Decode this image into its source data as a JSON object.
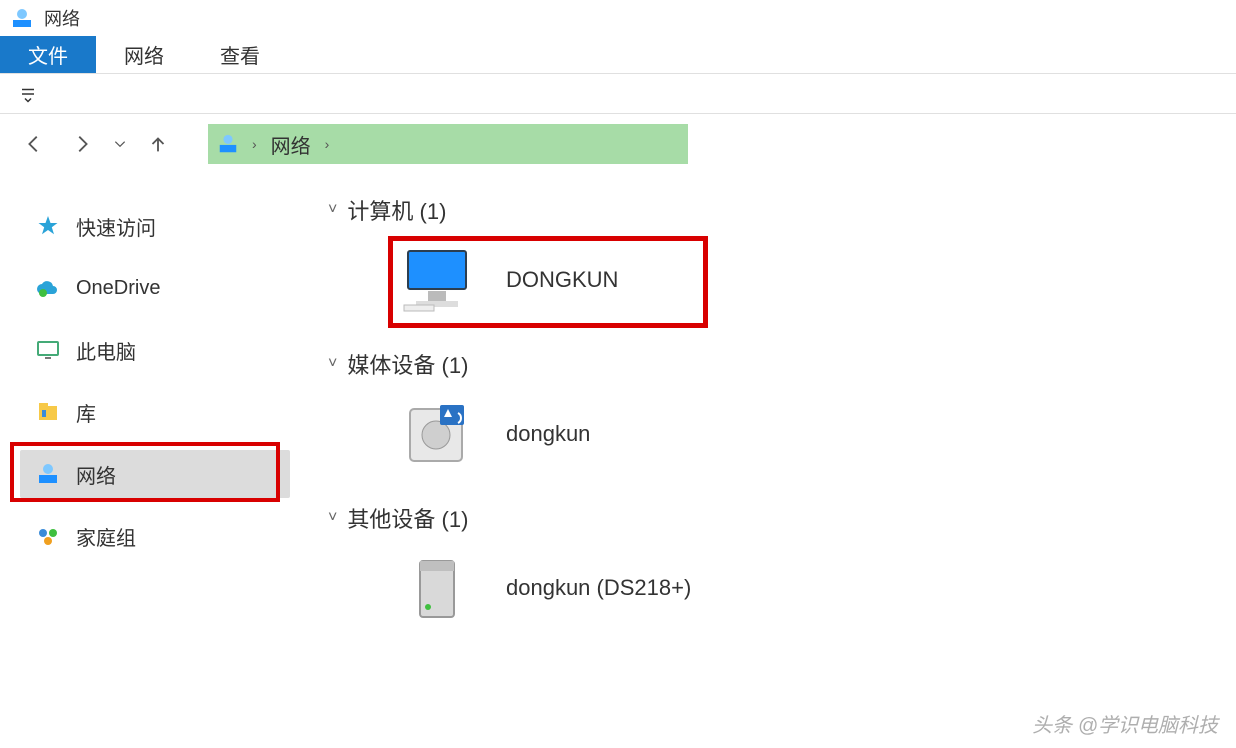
{
  "title": "网络",
  "ribbon": {
    "file": "文件",
    "tabs": [
      "网络",
      "查看"
    ]
  },
  "nav": {
    "crumb": "网络"
  },
  "sidebar": {
    "items": [
      {
        "id": "quick-access",
        "label": "快速访问"
      },
      {
        "id": "onedrive",
        "label": "OneDrive"
      },
      {
        "id": "this-pc",
        "label": "此电脑"
      },
      {
        "id": "libraries",
        "label": "库"
      },
      {
        "id": "network",
        "label": "网络",
        "selected": true
      },
      {
        "id": "homegroup",
        "label": "家庭组"
      }
    ]
  },
  "groups": [
    {
      "id": "computers",
      "header": "计算机",
      "count": 1,
      "items": [
        {
          "id": "dongkun-pc",
          "label": "DONGKUN",
          "highlighted": true
        }
      ]
    },
    {
      "id": "media",
      "header": "媒体设备",
      "count": 1,
      "items": [
        {
          "id": "dongkun-media",
          "label": "dongkun"
        }
      ]
    },
    {
      "id": "other",
      "header": "其他设备",
      "count": 1,
      "items": [
        {
          "id": "dongkun-nas",
          "label": "dongkun (DS218+)"
        }
      ]
    }
  ],
  "watermark": "头条 @学识电脑科技"
}
